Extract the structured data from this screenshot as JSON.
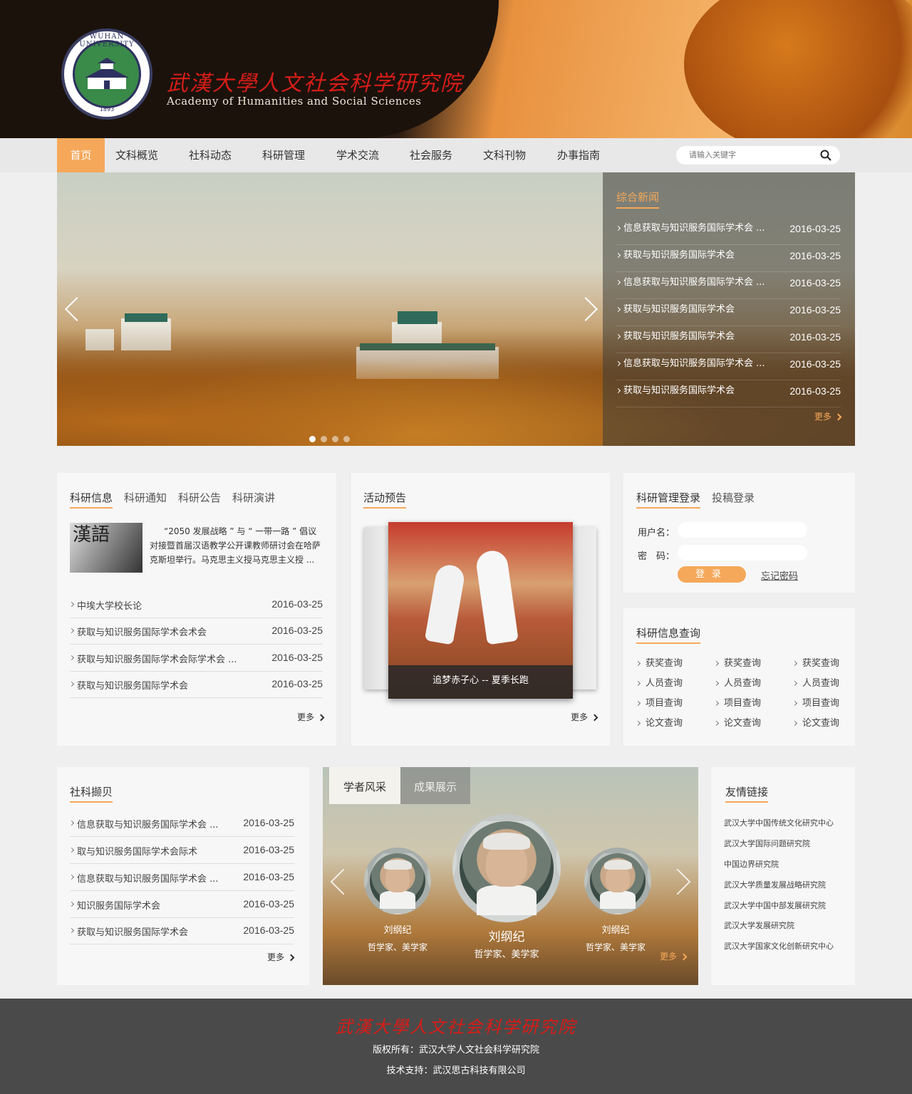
{
  "header": {
    "logo_ring_text": "WUHAN UNIVERSITY",
    "logo_year": "1893",
    "site_name_cn": "武漢大學人文社会科学研究院",
    "site_name_en": "Academy of Humanities and Social Sciences"
  },
  "nav": {
    "items": [
      "首页",
      "文科概览",
      "社科动态",
      "科研管理",
      "学术交流",
      "社会服务",
      "文科刊物",
      "办事指南"
    ],
    "search_placeholder": "请输入关键字"
  },
  "news": {
    "title": "综合新闻",
    "rows": [
      {
        "title": "信息获取与知识服务国际学术会 ...",
        "date": "2016-03-25"
      },
      {
        "title": "获取与知识服务国际学术会",
        "date": "2016-03-25"
      },
      {
        "title": "信息获取与知识服务国际学术会 ...",
        "date": "2016-03-25"
      },
      {
        "title": "获取与知识服务国际学术会",
        "date": "2016-03-25"
      },
      {
        "title": "获取与知识服务国际学术会",
        "date": "2016-03-25"
      },
      {
        "title": "信息获取与知识服务国际学术会 ...",
        "date": "2016-03-25"
      },
      {
        "title": "获取与知识服务国际学术会",
        "date": "2016-03-25"
      }
    ],
    "more": "更多"
  },
  "research": {
    "tabs": [
      "科研信息",
      "科研通知",
      "科研公告",
      "科研演讲"
    ],
    "thumb_text": "漢語",
    "feature": "“2050 发展战略 ” 与 “ 一带一路 ” 倡议对接暨首届汉语教学公开课教师研讨会在哈萨克斯坦举行。马克思主义授马克思主义授 ...",
    "rows": [
      {
        "title": "中埃大学校长论",
        "date": "2016-03-25"
      },
      {
        "title": "获取与知识服务国际学术会术会",
        "date": "2016-03-25"
      },
      {
        "title": "获取与知识服务国际学术会际学术会 ...",
        "date": "2016-03-25"
      },
      {
        "title": "获取与知识服务国际学术会",
        "date": "2016-03-25"
      }
    ],
    "more": "更多"
  },
  "events": {
    "title": "活动预告",
    "caption": "追梦赤子心 -- 夏季长跑",
    "more": "更多"
  },
  "login": {
    "tabs": [
      "科研管理登录",
      "投稿登录"
    ],
    "user_label": "用户名：",
    "pass_label": "密　码：",
    "button": "登录",
    "forgot": "忘记密码"
  },
  "query": {
    "title": "科研信息查询",
    "grid": [
      [
        "获奖查询",
        "获奖查询",
        "获奖查询"
      ],
      [
        "人员查询",
        "人员查询",
        "人员查询"
      ],
      [
        "项目查询",
        "项目查询",
        "项目查询"
      ],
      [
        "论文查询",
        "论文查询",
        "论文查询"
      ]
    ]
  },
  "digest": {
    "title": "社科撷贝",
    "rows": [
      {
        "title": "信息获取与知识服务国际学术会 ...",
        "date": "2016-03-25"
      },
      {
        "title": "取与知识服务国际学术会际术",
        "date": "2016-03-25"
      },
      {
        "title": "信息获取与知识服务国际学术会 ...",
        "date": "2016-03-25"
      },
      {
        "title": "知识服务国际学术会",
        "date": "2016-03-25"
      },
      {
        "title": "获取与知识服务国际学术会",
        "date": "2016-03-25"
      }
    ],
    "more": "更多"
  },
  "scholars": {
    "tabs": [
      "学者风采",
      "成果展示"
    ],
    "people": [
      {
        "name": "刘纲纪",
        "title": "哲学家、美学家"
      },
      {
        "name": "刘纲纪",
        "title": "哲学家、美学家"
      },
      {
        "name": "刘纲纪",
        "title": "哲学家、美学家"
      }
    ],
    "more": "更多"
  },
  "links": {
    "title": "友情链接",
    "items": [
      "武汉大学中国传统文化研究中心",
      "武汉大学国际问题研究院",
      "中国边界研究院",
      "武汉大学质量发展战略研究院",
      "武汉大学中国中部发展研究院",
      "武汉大学发展研究院",
      "武汉大学国家文化创新研究中心"
    ]
  },
  "footer": {
    "name": "武漢大學人文社会科学研究院",
    "copyright": "版权所有：武汉大学人文社会科学研究院",
    "support": "技术支持：武汉思古科技有限公司"
  },
  "colors": {
    "accent": "#f5a85a",
    "footer_bg": "#4a4a4a",
    "nav_bg": "#e8e8e8"
  }
}
